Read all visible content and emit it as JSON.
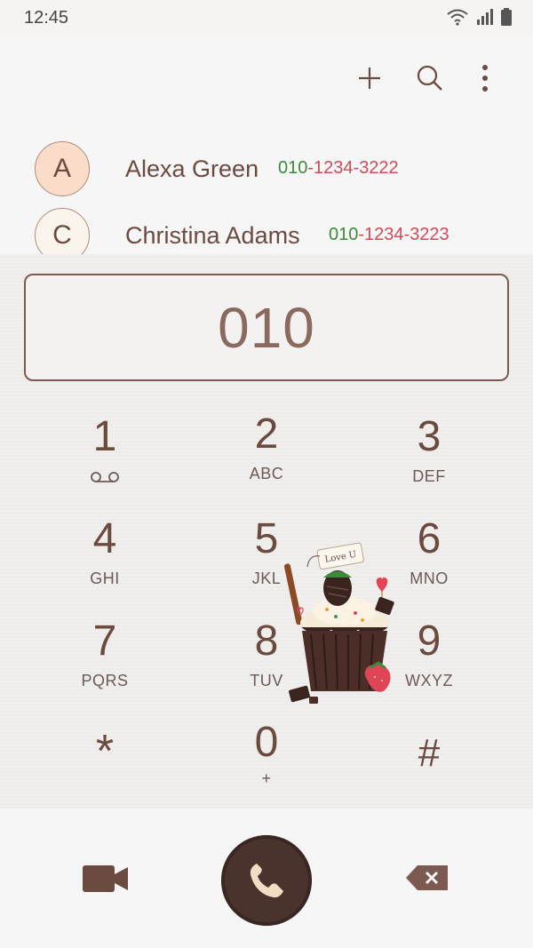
{
  "status": {
    "time": "12:45"
  },
  "toolbar": {
    "add_icon": "plus-icon",
    "search_icon": "search-icon",
    "more_icon": "more-vertical-icon"
  },
  "contacts": [
    {
      "initial": "A",
      "name": "Alexa Green",
      "number_prefix": "010",
      "number_rest": "-1234-3222",
      "avatar_color": "#f9ddc9"
    },
    {
      "initial": "C",
      "name": "Christina Adams",
      "number_prefix": "010",
      "number_rest": "-1234-3223",
      "avatar_color": "#faf5ec"
    }
  ],
  "dial": {
    "entered": "010"
  },
  "keys": [
    {
      "digit": "1",
      "letters": ""
    },
    {
      "digit": "2",
      "letters": "ABC"
    },
    {
      "digit": "3",
      "letters": "DEF"
    },
    {
      "digit": "4",
      "letters": "GHI"
    },
    {
      "digit": "5",
      "letters": "JKL"
    },
    {
      "digit": "6",
      "letters": "MNO"
    },
    {
      "digit": "7",
      "letters": "PQRS"
    },
    {
      "digit": "8",
      "letters": "TUV"
    },
    {
      "digit": "9",
      "letters": "WXYZ"
    },
    {
      "digit": "*",
      "letters": ""
    },
    {
      "digit": "0",
      "letters": "+"
    },
    {
      "digit": "#",
      "letters": ""
    }
  ],
  "decoration": {
    "tag_text": "Love U"
  },
  "colors": {
    "accent": "#6b4a40",
    "call_button": "#4a332d",
    "number_prefix": "#3f8a3a",
    "number_rest": "#cd4c5a"
  }
}
